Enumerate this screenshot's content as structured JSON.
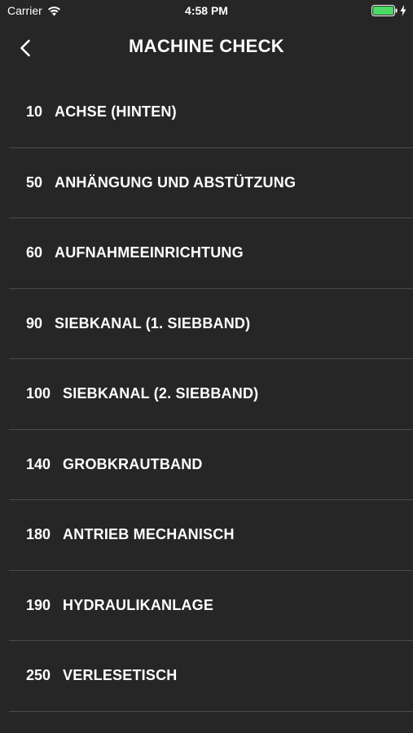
{
  "status_bar": {
    "carrier": "Carrier",
    "time": "4:58 PM",
    "wifi_icon": "wifi-icon",
    "battery_icon": "battery-icon",
    "charging_icon": "bolt-icon",
    "battery_color": "#4cd964"
  },
  "nav": {
    "title": "MACHINE CHECK",
    "back_icon": "chevron-left-icon"
  },
  "list": {
    "items": [
      {
        "code": "10",
        "label": "ACHSE (HINTEN)"
      },
      {
        "code": "50",
        "label": "ANHÄNGUNG UND ABSTÜTZUNG"
      },
      {
        "code": "60",
        "label": "AUFNAHMEEINRICHTUNG"
      },
      {
        "code": "90",
        "label": "SIEBKANAL (1. SIEBBAND)"
      },
      {
        "code": "100",
        "label": "SIEBKANAL (2. SIEBBAND)"
      },
      {
        "code": "140",
        "label": "GROBKRAUTBAND"
      },
      {
        "code": "180",
        "label": "ANTRIEB MECHANISCH"
      },
      {
        "code": "190",
        "label": "HYDRAULIKANLAGE"
      },
      {
        "code": "250",
        "label": "VERLESETISCH"
      }
    ]
  },
  "colors": {
    "background": "#262626",
    "separator": "#4a4a4a",
    "text": "#ffffff"
  }
}
